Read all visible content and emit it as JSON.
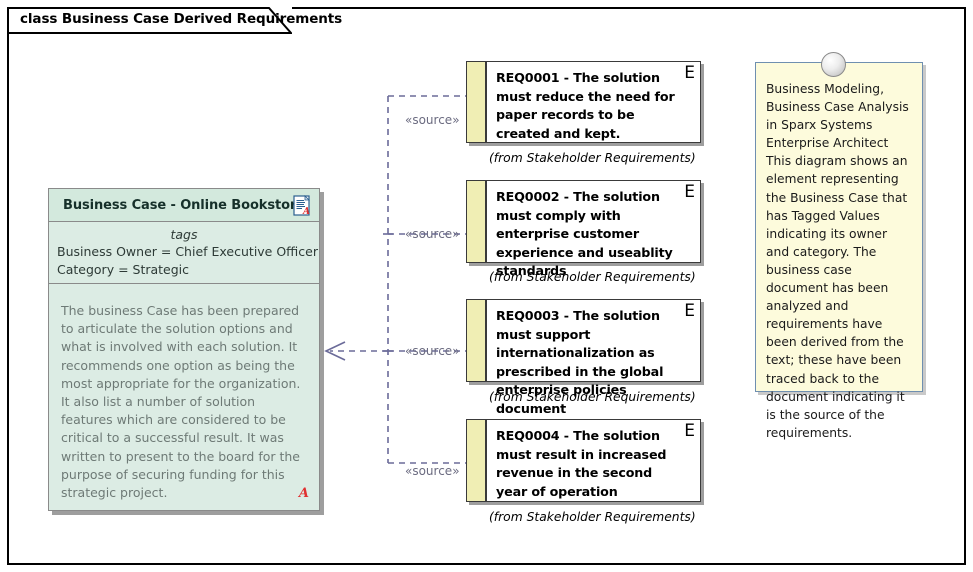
{
  "diagram": {
    "title": "class Business Case Derived Requirements",
    "kind_prefix": "class",
    "name": "Business Case Derived Requirements"
  },
  "business_case": {
    "name": "Business Case - Online Bookstore",
    "doc_icon": "document-icon",
    "tags_label": "tags",
    "tags": [
      "Business Owner = Chief Executive Officer",
      "Category = Strategic"
    ],
    "notes": "The business Case has been prepared to articulate the solution options and what is involved with each solution. It recommends one option as being the most appropriate for the organization. It also list a number of solution features which are considered to be critical to a successful result. It was written to present to the board for the purpose of securing funding for this strategic project.",
    "notes_marker": "A"
  },
  "requirements": [
    {
      "text": "REQ0001 - The solution must reduce the need for paper records to be created and kept.",
      "marker": "E",
      "from": "(from Stakeholder Requirements)"
    },
    {
      "text": "REQ0002 - The solution must comply with enterprise customer experience and useablity standards",
      "marker": "E",
      "from": "(from Stakeholder Requirements)"
    },
    {
      "text": "REQ0003 - The solution must support internationalization as prescribed in the global enterprise policies document",
      "marker": "E",
      "from": "(from Stakeholder Requirements)"
    },
    {
      "text": "REQ0004 - The solution must result in increased revenue in the second year of operation",
      "marker": "E",
      "from": "(from Stakeholder Requirements)"
    }
  ],
  "connectors": [
    {
      "stereotype": "«source»"
    },
    {
      "stereotype": "«source»"
    },
    {
      "stereotype": "«source»"
    },
    {
      "stereotype": "«source»"
    }
  ],
  "note": {
    "text": "Business Modeling, Business Case Analysis in Sparx Systems Enterprise Architect\nThis diagram shows an element representing the Business Case that has Tagged Values indicating its owner and category. The business case document has been analyzed and requirements have been derived from the text; these have been traced back to the document indicating it is the source of the requirements.",
    "pin": "note-pin-icon"
  },
  "colors": {
    "business_case_fill": "#dcece4",
    "business_case_header": "#d3e9dd",
    "requirement_bar": "#f0eeb4",
    "note_fill": "#fdfbdc",
    "note_border": "#6f8fb0",
    "connector": "#6b6b99",
    "marker_red": "#e03030"
  }
}
